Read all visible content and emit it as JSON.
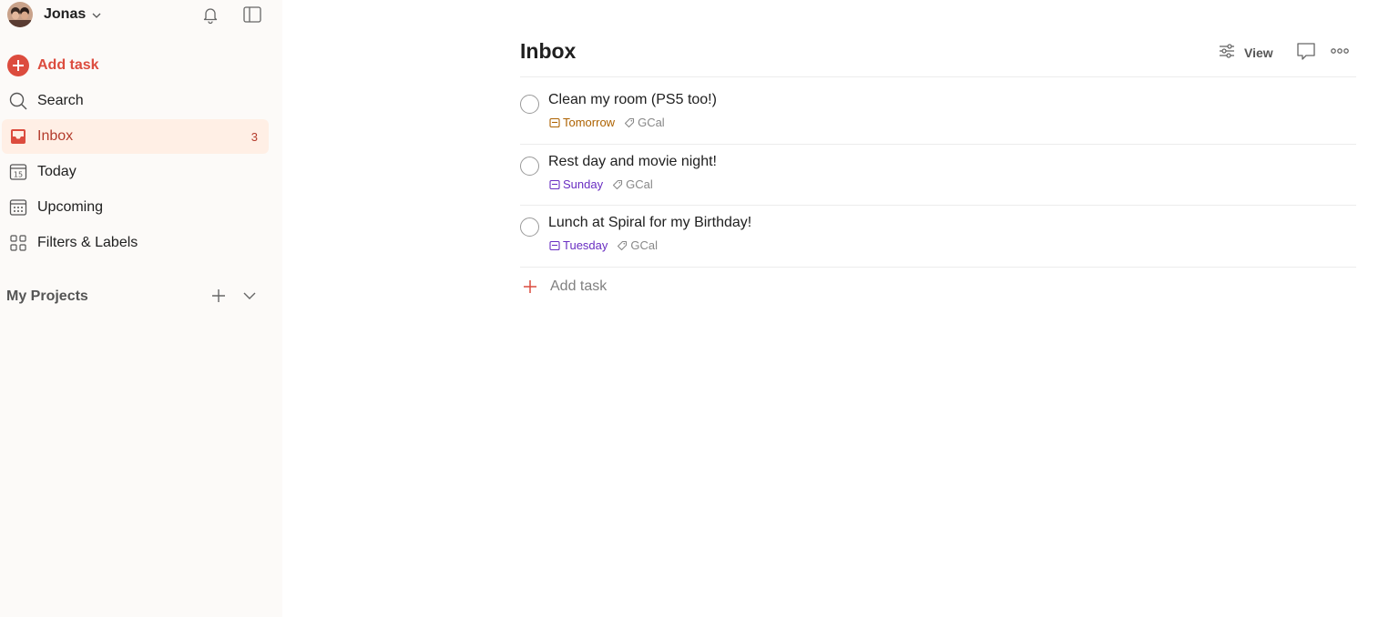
{
  "colors": {
    "accent": "#dc4c3e",
    "sidebar_bg": "#fcfaf8",
    "active_bg": "#ffefe5",
    "tomorrow": "#ad6200",
    "weekday": "#692ec2"
  },
  "user": {
    "name": "Jonas"
  },
  "sidebar": {
    "add_task": "Add task",
    "items": [
      {
        "label": "Search",
        "icon": "search-icon"
      },
      {
        "label": "Inbox",
        "icon": "inbox-icon",
        "count": "3",
        "active": true
      },
      {
        "label": "Today",
        "icon": "calendar-today-icon",
        "day": "15"
      },
      {
        "label": "Upcoming",
        "icon": "calendar-grid-icon"
      },
      {
        "label": "Filters & Labels",
        "icon": "grid-icon"
      }
    ],
    "projects_title": "My Projects"
  },
  "main": {
    "title": "Inbox",
    "view_label": "View",
    "tasks": [
      {
        "content": "Clean my room (PS5 too!)",
        "due": "Tomorrow",
        "label": "GCal"
      },
      {
        "content": "Rest day and movie night!",
        "due": "Sunday",
        "label": "GCal"
      },
      {
        "content": "Lunch at Spiral for my Birthday!",
        "due": "Tuesday",
        "label": "GCal"
      }
    ],
    "add_task": "Add task"
  }
}
